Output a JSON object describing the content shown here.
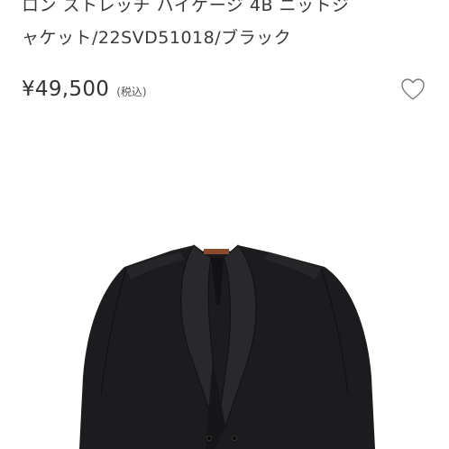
{
  "product": {
    "title_line_1": "ロン ストレッチ ハイゲージ 4B ニットジ",
    "title_line_2": "ャケット/22SVD51018/ブラック",
    "price": "¥49,500",
    "tax_note": "(税込)"
  },
  "icons": {
    "favorite": "heart-outline-icon"
  },
  "colors": {
    "text": "#3a3a3a",
    "jacket": "#1c1c1e",
    "label": "#8a4a2c"
  }
}
